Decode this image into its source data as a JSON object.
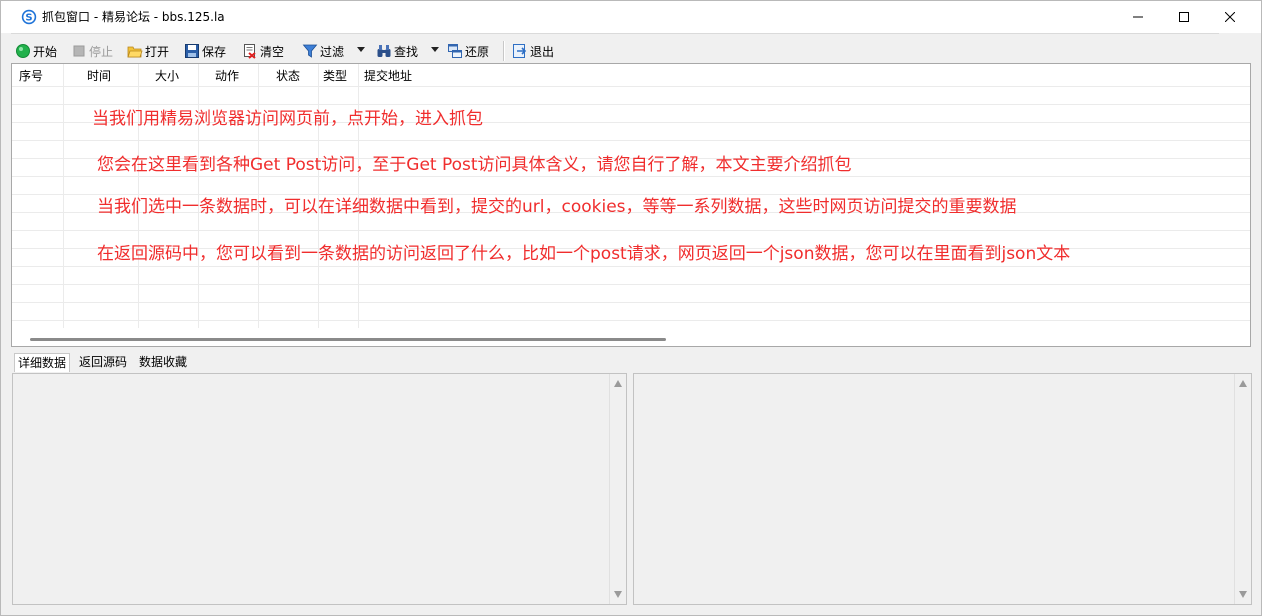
{
  "window": {
    "title": "抓包窗口 - 精易论坛 - bbs.125.la"
  },
  "toolbar": {
    "start": "开始",
    "stop": "停止",
    "open": "打开",
    "save": "保存",
    "clear": "清空",
    "filter": "过滤",
    "find": "查找",
    "restore": "还原",
    "exit": "退出"
  },
  "packet_list": {
    "columns": [
      "序号",
      "时间",
      "大小",
      "动作",
      "状态",
      "类型",
      "提交地址"
    ]
  },
  "annotations": [
    "当我们用精易浏览器访问网页前，点开始，进入抓包",
    "您会在这里看到各种Get Post访问，至于Get Post访问具体含义，请您自行了解，本文主要介绍抓包",
    "当我们选中一条数据时，可以在详细数据中看到，提交的url，cookies，等等一系列数据，这些时网页访问提交的重要数据",
    "在返回源码中，您可以看到一条数据的访问返回了什么，比如一个post请求，网页返回一个json数据，您可以在里面看到json文本"
  ],
  "tabs": [
    {
      "label": "详细数据",
      "active": true
    },
    {
      "label": "返回源码",
      "active": false
    },
    {
      "label": "数据收藏",
      "active": false
    }
  ],
  "colors": {
    "annotation": "#f02d2d",
    "start_icon": "#22b14c"
  }
}
